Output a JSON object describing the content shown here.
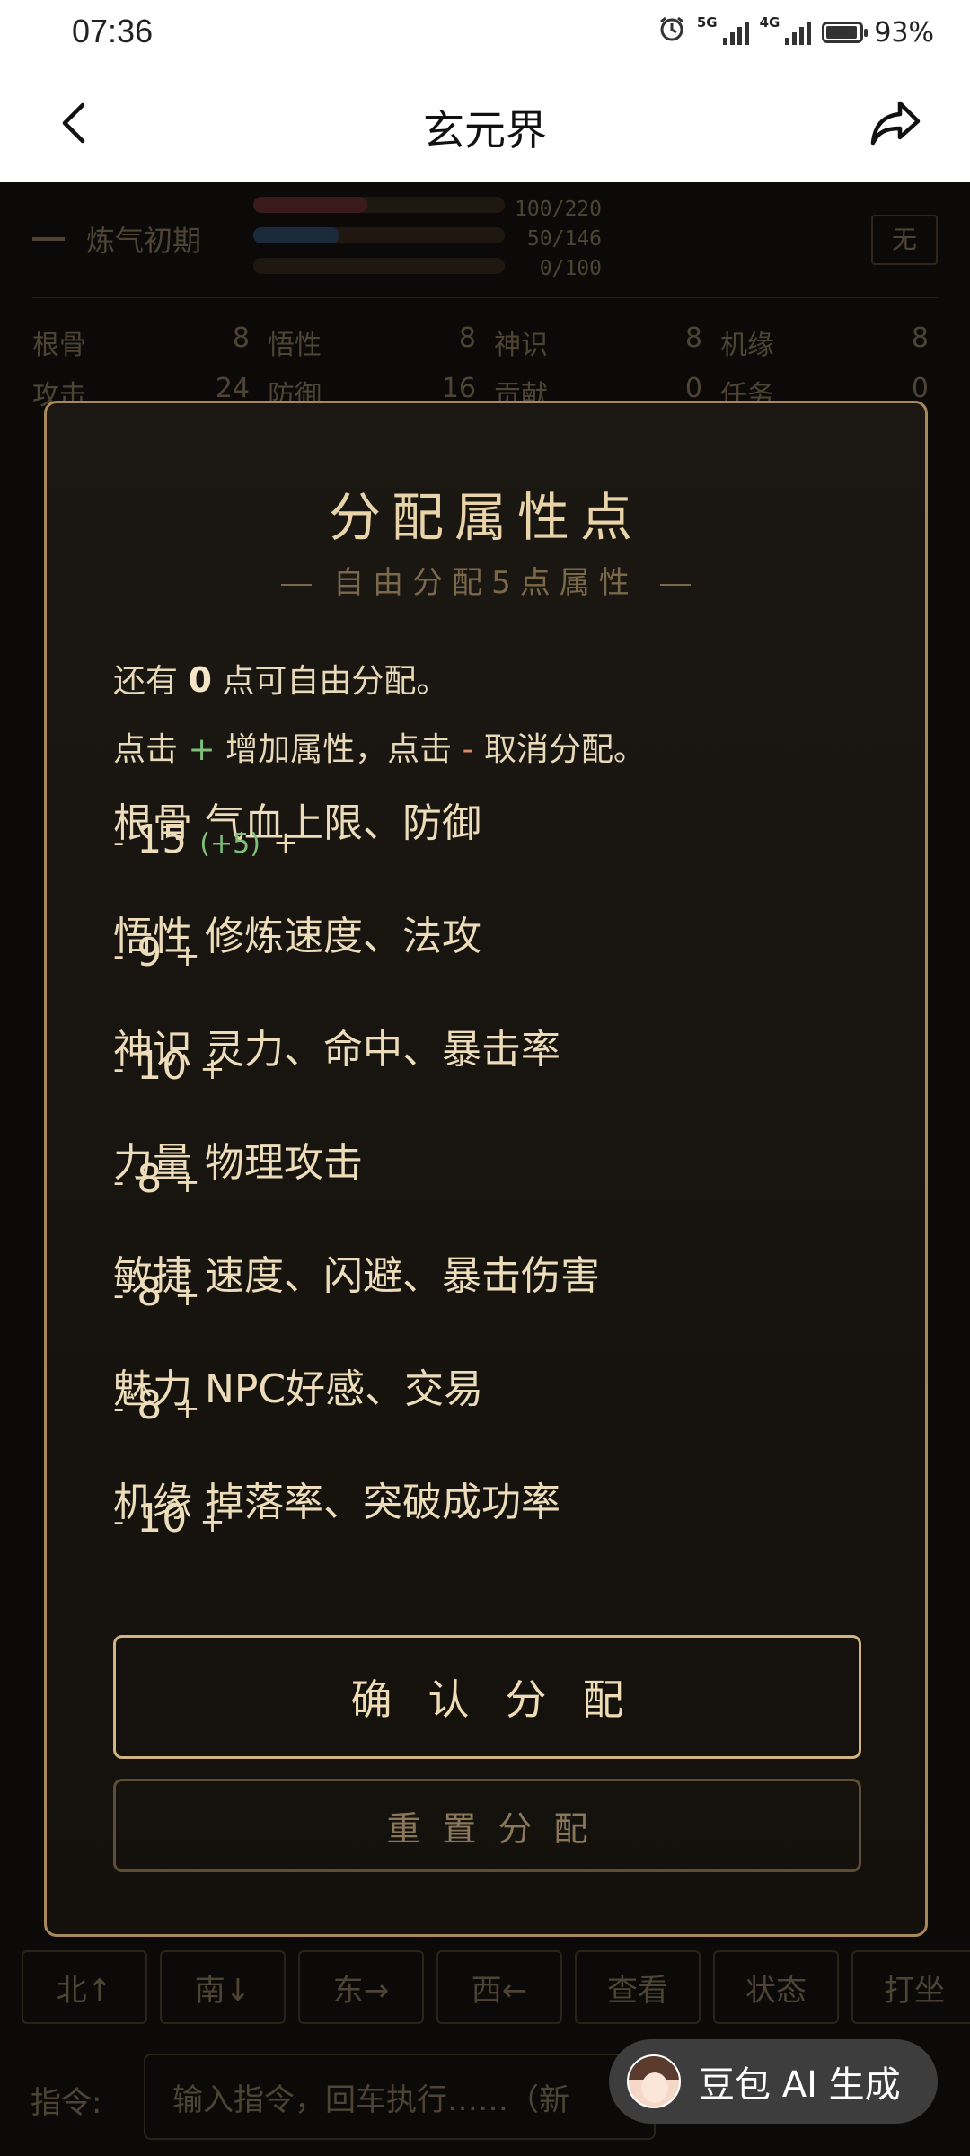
{
  "status_bar": {
    "time": "07:36",
    "network_1": "5G",
    "network_2": "4G",
    "battery": "93%",
    "battery_level": 0.93
  },
  "app_bar": {
    "title": "玄元界",
    "back_icon": "chevron-left-icon",
    "share_icon": "share-arrow-icon"
  },
  "background": {
    "realm": "炼气初期",
    "bars": [
      {
        "text": "100/220",
        "fraction": 0.4545,
        "color": "#3a1a1a"
      },
      {
        "text": "50/146",
        "fraction": 0.3425,
        "color": "#1a2a3a"
      },
      {
        "text": "0/100",
        "fraction": 0,
        "color": "#2a2418"
      }
    ],
    "none_button": "无",
    "stats": [
      [
        {
          "label": "根骨",
          "value": "8"
        },
        {
          "label": "悟性",
          "value": "8"
        },
        {
          "label": "神识",
          "value": "8"
        },
        {
          "label": "机缘",
          "value": "8"
        }
      ],
      [
        {
          "label": "攻击",
          "value": "24"
        },
        {
          "label": "防御",
          "value": "16"
        },
        {
          "label": "贡献",
          "value": "0"
        },
        {
          "label": "任务",
          "value": "0"
        }
      ]
    ],
    "directions": [
      "北↑",
      "南↓",
      "东→",
      "西←",
      "查看",
      "状态",
      "打坐"
    ],
    "command_label": "指令:",
    "command_placeholder": "输入指令，回车执行……（新"
  },
  "modal": {
    "title": "分配属性点",
    "subtitle": "自由分配5点属性",
    "remaining_prefix": "还有",
    "remaining_points": "0",
    "remaining_suffix": "点可自由分配。",
    "hint_1": "点击",
    "hint_plus": "+",
    "hint_2": "增加属性，点击",
    "hint_minus": "-",
    "hint_3": "取消分配。",
    "attributes": [
      {
        "name": "根骨 气血上限、防御",
        "value": "15",
        "bonus": "(+5)"
      },
      {
        "name": "悟性 修炼速度、法攻",
        "value": "9",
        "bonus": ""
      },
      {
        "name": "神识 灵力、命中、暴击率",
        "value": "10",
        "bonus": ""
      },
      {
        "name": "力量 物理攻击",
        "value": "8",
        "bonus": ""
      },
      {
        "name": "敏捷 速度、闪避、暴击伤害",
        "value": "8",
        "bonus": ""
      },
      {
        "name": "魅力 NPC好感、交易",
        "value": "8",
        "bonus": ""
      },
      {
        "name": "机缘 掉落率、突破成功率",
        "value": "10",
        "bonus": ""
      }
    ],
    "minus_symbol": "-",
    "plus_symbol": "+",
    "confirm_label": "确认分配",
    "reset_label": "重置分配"
  },
  "ai_badge": {
    "label": "豆包 AI 生成"
  }
}
